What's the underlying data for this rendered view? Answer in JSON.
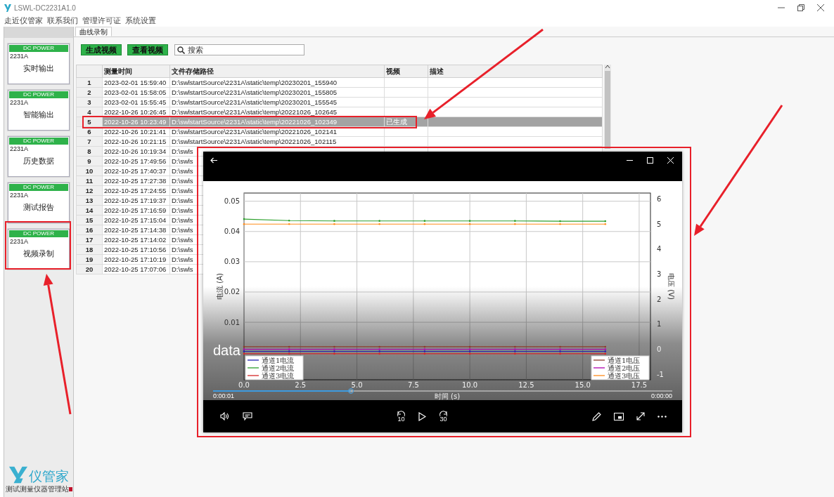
{
  "window": {
    "title": "LSWL-DC2231A1.0"
  },
  "menu": [
    "走近仪管家",
    "联系我们",
    "管理许可证",
    "系统设置"
  ],
  "sidebar": {
    "items": [
      {
        "header": "DC POWER",
        "model": "2231A",
        "label": "实时输出"
      },
      {
        "header": "DC POWER",
        "model": "2231A",
        "label": "智能输出"
      },
      {
        "header": "DC POWER",
        "model": "2231A",
        "label": "历史数据"
      },
      {
        "header": "DC POWER",
        "model": "2231A",
        "label": "测试报告"
      },
      {
        "header": "DC POWER",
        "model": "2231A",
        "label": "视频录制"
      }
    ],
    "logo": {
      "name": "仪管家",
      "subtitle": "测试测量仪器管理站"
    }
  },
  "tabs": [
    {
      "label": "曲线录制",
      "selected": true
    }
  ],
  "toolbar": {
    "buttons": [
      "生成视频",
      "查看视频"
    ],
    "search": {
      "placeholder": "搜索"
    }
  },
  "table": {
    "columns": [
      "测量时间",
      "文件存储路径",
      "视频",
      "描述"
    ],
    "rows": [
      {
        "index": "1",
        "time": "2023-02-01 15:59:40",
        "path": "D:\\swlstartSource\\2231A\\static\\temp\\20230201_155940",
        "selected": false
      },
      {
        "index": "2",
        "time": "2023-02-01 15:58:05",
        "path": "D:\\swlstartSource\\2231A\\static\\temp\\20230201_155805",
        "selected": false
      },
      {
        "index": "3",
        "time": "2023-02-01 15:55:45",
        "path": "D:\\swlstartSource\\2231A\\static\\temp\\20230201_155545",
        "selected": false
      },
      {
        "index": "4",
        "time": "2022-10-26 10:26:45",
        "path": "D:\\swlstartSource\\2231A\\static\\temp\\20221026_102645",
        "selected": false
      },
      {
        "index": "5",
        "time": "2022-10-26 10:23:49",
        "path": "D:\\swlstartSource\\2231A\\static\\temp\\20221026_102349",
        "video": "已生成",
        "selected": true
      },
      {
        "index": "6",
        "time": "2022-10-26 10:21:41",
        "path": "D:\\swlstartSource\\2231A\\static\\temp\\20221026_102141",
        "selected": false
      },
      {
        "index": "7",
        "time": "2022-10-26 10:21:15",
        "path": "D:\\swlstartSource\\2231A\\static\\temp\\20221026_102115",
        "selected": false
      },
      {
        "index": "8",
        "time": "2022-10-26 10:19:34",
        "path": "D:\\swls",
        "selected": false
      },
      {
        "index": "9",
        "time": "2022-10-25 17:49:56",
        "path": "D:\\swls",
        "selected": false
      },
      {
        "index": "10",
        "time": "2022-10-25 17:40:37",
        "path": "D:\\swls",
        "selected": false
      },
      {
        "index": "11",
        "time": "2022-10-25 17:27:38",
        "path": "D:\\swls",
        "selected": false
      },
      {
        "index": "12",
        "time": "2022-10-25 17:24:55",
        "path": "D:\\swls",
        "selected": false
      },
      {
        "index": "13",
        "time": "2022-10-25 17:19:37",
        "path": "D:\\swls",
        "selected": false
      },
      {
        "index": "14",
        "time": "2022-10-25 17:16:59",
        "path": "D:\\swls",
        "selected": false
      },
      {
        "index": "15",
        "time": "2022-10-25 17:15:04",
        "path": "D:\\swls",
        "selected": false
      },
      {
        "index": "16",
        "time": "2022-10-25 17:14:38",
        "path": "D:\\swls",
        "selected": false
      },
      {
        "index": "17",
        "time": "2022-10-25 17:14:02",
        "path": "D:\\swls",
        "selected": false
      },
      {
        "index": "18",
        "time": "2022-10-25 17:10:56",
        "path": "D:\\swls",
        "selected": false
      },
      {
        "index": "19",
        "time": "2022-10-25 17:10:19",
        "path": "D:\\swls",
        "selected": false
      },
      {
        "index": "20",
        "time": "2022-10-25 17:07:06",
        "path": "D:\\swls",
        "selected": false
      }
    ]
  },
  "player": {
    "title": "data",
    "elapsed": "0:00:01",
    "remaining": "0:00:00",
    "progress": {
      "level": 0.3
    },
    "rewind_label": "10",
    "forward_label": "30",
    "chart_data": {
      "type": "line",
      "xlabel": "时间 (s)",
      "ylabel": "电流 (A)",
      "y2label": "电压 (V)",
      "y2lim": [
        -1.22,
        6.24
      ],
      "y2ticks": [
        -1,
        0,
        1,
        2,
        3,
        4,
        5,
        6
      ],
      "grid": true,
      "legend": "lower left, lower right",
      "x": [
        0,
        2,
        4,
        6,
        8,
        10,
        12,
        14,
        16
      ],
      "xlim": [
        0,
        18
      ],
      "ylim": [
        -0.009,
        0.0527
      ],
      "xticks": [
        {
          "value": 0,
          "label": "0.0"
        },
        {
          "value": 2.5,
          "label": "2.5"
        },
        {
          "value": 5,
          "label": "5.0"
        },
        {
          "value": 7.5,
          "label": "7.5"
        },
        {
          "value": 10,
          "label": "10.0"
        },
        {
          "value": 12.5,
          "label": "12.5"
        },
        {
          "value": 15,
          "label": "15.0"
        },
        {
          "value": 17.5,
          "label": "17.5"
        }
      ],
      "yticks": [
        0.01,
        0.02,
        0.03,
        0.04,
        0.05
      ],
      "series": [
        {
          "name": "通道1电流",
          "color": "#2020b0",
          "values": [
            0.0004,
            0.0004,
            0.0004,
            0.0004,
            0.0004,
            0.0004,
            0.0004,
            0.0004,
            0.0004
          ]
        },
        {
          "name": "通道2电流",
          "color": "#2ca02c",
          "values": [
            0.0441,
            0.0436,
            0.0435,
            0.0435,
            0.0435,
            0.0435,
            0.0435,
            0.0434,
            0.0434
          ]
        },
        {
          "name": "通道3电流",
          "color": "#d62728",
          "values": [
            -0.0004,
            -0.0004,
            -0.0004,
            -0.0004,
            -0.0004,
            -0.0004,
            -0.0004,
            -0.0004,
            -0.0004
          ]
        },
        {
          "name": "通道1电压",
          "color": "#8c3b2b",
          "axis": "y2",
          "values": [
            0.1,
            0.1,
            0.1,
            0.1,
            0.1,
            0.1,
            0.1,
            0.1,
            0.1
          ]
        },
        {
          "name": "通道2电压",
          "color": "#b000b0",
          "axis": "y2",
          "values": [
            0,
            0,
            0,
            0,
            0,
            0,
            0,
            0,
            0
          ]
        },
        {
          "name": "通道3电压",
          "color": "#ff8c1a",
          "axis": "y2",
          "values": [
            5,
            5,
            5,
            5,
            5,
            5,
            5,
            5,
            5
          ]
        }
      ]
    }
  }
}
